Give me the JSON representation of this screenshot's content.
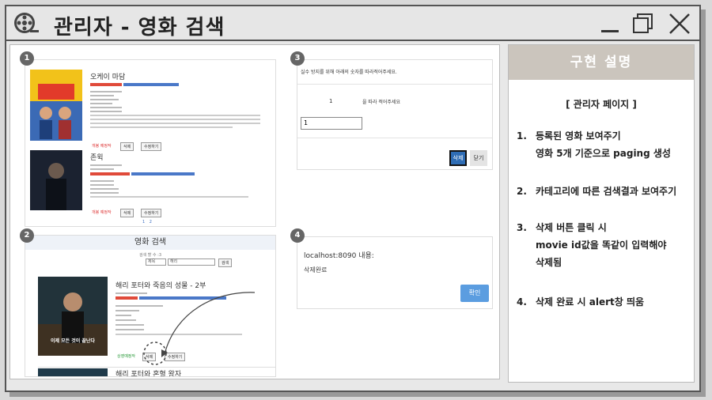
{
  "window": {
    "title": "관리자 - 영화 검색",
    "icons": {
      "reel": "film-reel-icon",
      "minimize": "minimize-icon",
      "maximize": "maximize-icon",
      "close": "close-icon"
    }
  },
  "badges": [
    "1",
    "2",
    "3",
    "4"
  ],
  "panel1": {
    "movies": [
      {
        "title": "오케이 마담",
        "tags": [
          "",
          ""
        ],
        "actions": [
          "삭제",
          "수정하기"
        ],
        "status": "개봉 예정작"
      },
      {
        "title": "존윅",
        "tags": [
          "",
          ""
        ],
        "actions": [
          "삭제",
          "수정하기"
        ],
        "status": "개봉 예정작"
      }
    ],
    "pages": [
      "1",
      "2"
    ]
  },
  "panel2": {
    "header": "영화 검색",
    "search_caption": "검색 할 수 :3",
    "select_value": "제목",
    "search_value": "해리",
    "search_button": "검색",
    "movie1_title": "해리 포터와 죽음의 성물 - 2부",
    "poster_text": "이제 모든 것이 끝난다",
    "status": "상영예정작",
    "actions": [
      "삭제",
      "수정하기"
    ],
    "movie2_title": "해리 포터와 혼혈 왕자"
  },
  "panel3": {
    "instruction": "실수 방지를 위해 아래의 숫자를 따라적어주세요.",
    "code_number": "1",
    "code_hint": "을 따라 적어주세요",
    "input_value": "1",
    "delete_button": "삭제",
    "close_button": "닫기"
  },
  "panel4": {
    "host": "localhost:8090 내용:",
    "message": "삭제완료",
    "ok_button": "확인"
  },
  "side": {
    "header": "구현 설명",
    "subtitle": "[ 관리자 페이지 ]",
    "items": [
      {
        "num": "1.",
        "line1": "등록된 영화 보여주기",
        "line2": "영화 5개 기준으로 paging 생성"
      },
      {
        "num": "2.",
        "line1": "카테고리에 따른 검색결과 보여주기",
        "line2": ""
      },
      {
        "num": "3.",
        "line1": "삭제 버튼 클릭 시",
        "line2": "movie id값을 똑같이 입력해야",
        "line3": "삭제됨"
      },
      {
        "num": "4.",
        "line1": "삭제 완료 시 alert창 띄움",
        "line2": ""
      }
    ]
  },
  "colors": {
    "accent": "#3a6ec2",
    "side_header": "#cbc5bd",
    "ok_button": "#5b9de0"
  }
}
